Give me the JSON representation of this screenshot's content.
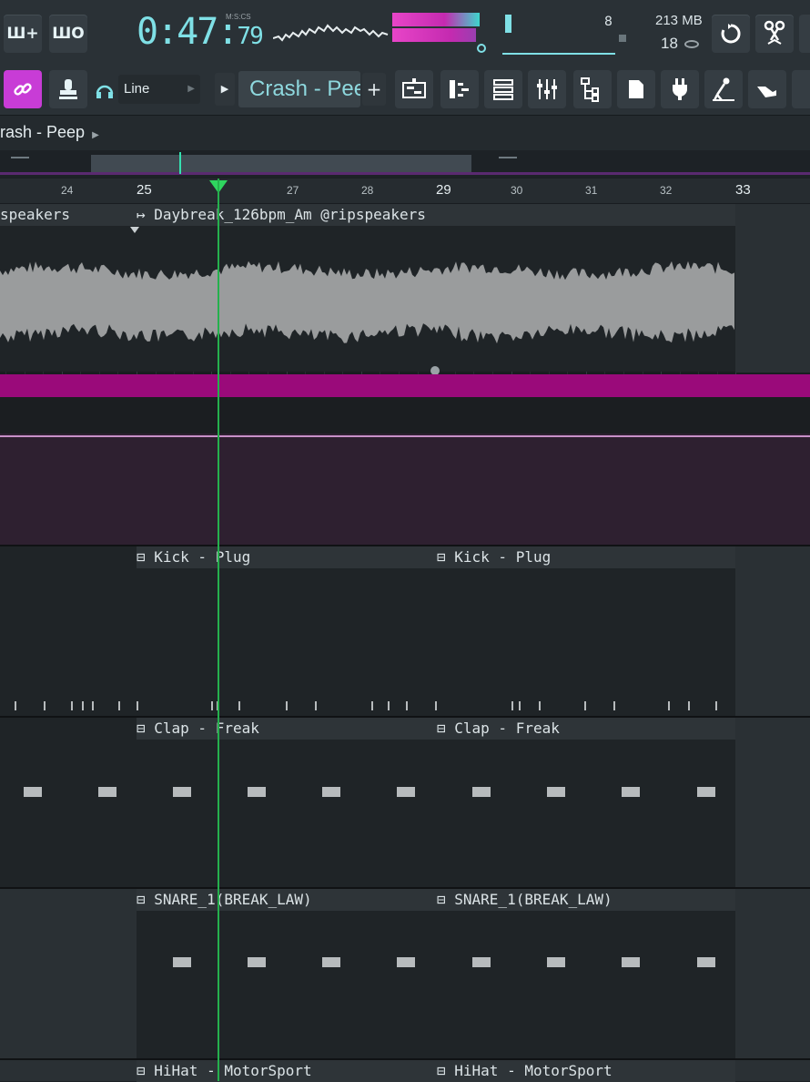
{
  "toolbar": {
    "btn_left_1": "Ш+",
    "btn_left_2": "ШО",
    "time": "0:47",
    "time_cs": "79",
    "time_format_label": "M:S:CS",
    "voices": "8",
    "memory": "213 MB",
    "polyphony": "18"
  },
  "toolbar2": {
    "snap_label": "Line",
    "pattern_name": "Crash - Peep",
    "add_label": "+"
  },
  "breadcrumb": {
    "label": "rash - Peep"
  },
  "ruler": {
    "bars": [
      "24",
      "25",
      "27",
      "28",
      "29",
      "30",
      "31",
      "32",
      "33"
    ]
  },
  "tracks": [
    {
      "clips": [
        {
          "name": "speakers"
        },
        {
          "name": "↦ Daybreak_126bpm_Am @ripspeakers"
        }
      ]
    },
    {
      "clips": [
        {
          "name": "⊟ Kick - Plug"
        },
        {
          "name": "⊟ Kick - Plug"
        }
      ]
    },
    {
      "clips": [
        {
          "name": "⊟ Clap - Freak"
        },
        {
          "name": "⊟ Clap - Freak"
        }
      ]
    },
    {
      "clips": [
        {
          "name": "⊟ SNARE_1(BREAK_LAW)"
        },
        {
          "name": "⊟ SNARE_1(BREAK_LAW)"
        }
      ]
    },
    {
      "clips": [
        {
          "name": "⊟ HiHat - MotorSport"
        },
        {
          "name": "⊟ HiHat - MotorSport"
        }
      ]
    }
  ],
  "colors": {
    "accent_cyan": "#7fe0e6",
    "accent_magenta": "#c4198f",
    "playhead_green": "#25b04d"
  }
}
